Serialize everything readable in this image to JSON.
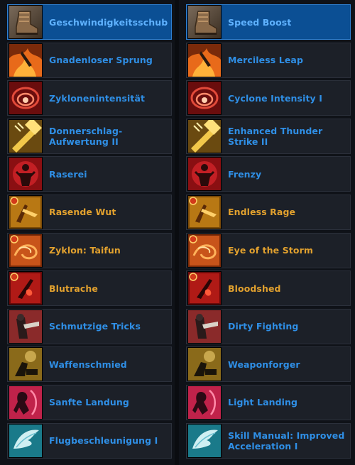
{
  "colors": {
    "blue_text": "#2f8fe6",
    "gold_text": "#e2a12e",
    "selected_bg": "#0b4f94",
    "row_bg": "#1c2028"
  },
  "left": {
    "items": [
      {
        "label": "Geschwindigkeitsschub",
        "icon": "boot-icon",
        "color": "blue",
        "selected": true
      },
      {
        "label": "Gnadenloser Sprung",
        "icon": "fire-leap-icon",
        "color": "blue"
      },
      {
        "label": "Zyklonenintensität",
        "icon": "cyclone-red-icon",
        "color": "blue"
      },
      {
        "label": "Donnerschlag-Aufwertung II",
        "icon": "thunder-hammer-icon",
        "color": "blue"
      },
      {
        "label": "Raserei",
        "icon": "frenzy-icon",
        "color": "blue"
      },
      {
        "label": "Rasende Wut",
        "icon": "rage-icon",
        "color": "gold"
      },
      {
        "label": "Zyklon: Taifun",
        "icon": "typhoon-icon",
        "color": "gold"
      },
      {
        "label": "Blutrache",
        "icon": "bloodshed-icon",
        "color": "gold"
      },
      {
        "label": "Schmutzige Tricks",
        "icon": "dirty-tricks-icon",
        "color": "blue"
      },
      {
        "label": "Waffenschmied",
        "icon": "weaponsmith-icon",
        "color": "blue"
      },
      {
        "label": "Sanfte Landung",
        "icon": "landing-icon",
        "color": "blue"
      },
      {
        "label": "Flugbeschleunigung I",
        "icon": "wing-icon",
        "color": "blue"
      }
    ]
  },
  "right": {
    "items": [
      {
        "label": "Speed Boost",
        "icon": "boot-icon",
        "color": "blue",
        "selected": true
      },
      {
        "label": "Merciless Leap",
        "icon": "fire-leap-icon",
        "color": "blue"
      },
      {
        "label": "Cyclone Intensity I",
        "icon": "cyclone-red-icon",
        "color": "blue"
      },
      {
        "label": "Enhanced Thunder Strike II",
        "icon": "thunder-hammer-icon",
        "color": "blue"
      },
      {
        "label": "Frenzy",
        "icon": "frenzy-icon",
        "color": "blue"
      },
      {
        "label": "Endless Rage",
        "icon": "rage-icon",
        "color": "gold"
      },
      {
        "label": "Eye of the Storm",
        "icon": "typhoon-icon",
        "color": "gold"
      },
      {
        "label": "Bloodshed",
        "icon": "bloodshed-icon",
        "color": "gold"
      },
      {
        "label": "Dirty Fighting",
        "icon": "dirty-tricks-icon",
        "color": "blue"
      },
      {
        "label": "Weaponforger",
        "icon": "weaponsmith-icon",
        "color": "blue"
      },
      {
        "label": "Light Landing",
        "icon": "landing-icon",
        "color": "blue"
      },
      {
        "label": "Skill Manual: Improved Acceleration I",
        "icon": "wing-icon",
        "color": "blue"
      }
    ]
  }
}
